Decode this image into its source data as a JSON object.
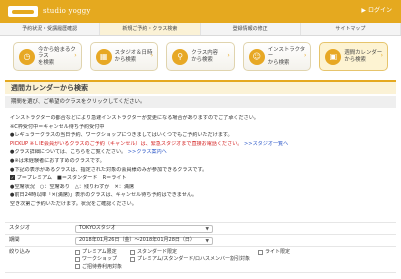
{
  "brand": {
    "name": "studio yoggy",
    "login_label": "ログイン",
    "logo_icon": "studio-logo"
  },
  "colors": {
    "accent": "#e5a91f",
    "highlight": "#fbf2d6",
    "warning": "#d31d1d",
    "link": "#2d58c8"
  },
  "global_nav": [
    "予約状況・受講履歴確認",
    "新規ご予約・クラス検索",
    "登録情報の修正",
    "サイトマップ"
  ],
  "tabs": [
    {
      "icon": "clock-icon",
      "line1": "今から始まるクラス",
      "line2": "を検索"
    },
    {
      "icon": "calendar-icon",
      "line1": "スタジオ＆日時",
      "line2": "から検索"
    },
    {
      "icon": "search-icon",
      "line1": "クラス内容",
      "line2": "から検索"
    },
    {
      "icon": "person-icon",
      "line1": "インストラクター",
      "line2": "から検索"
    },
    {
      "icon": "calendar-week-icon",
      "line1": "週間カレンダー",
      "line2": "から検索"
    }
  ],
  "page": {
    "title": "週間カレンダーから検索",
    "intro": "期間を選び、ご希望のクラスをクリックしてください。"
  },
  "notes": {
    "n1": "インストラクターの都合などにより急遽インストラクターが変更になる場合がありますのでご了承ください。",
    "n2": "※C枠受付中＝キャンセル待ち予約受付中",
    "n3": "●レギュラークラスの当日予約、ワークショップにつきましてはいくつでもご予約いただけます。",
    "n4_badge": "PICKUP",
    "n4_red": "※ＬIE会員がいるクラスのご予約（キャンセル）は、緊急スタジオまで直接お電話ください。",
    "n4_link": ">>スタジオ一覧へ",
    "n5": "●クラス詳細については、こちらをご覧ください。",
    "n5_link": ">>クラス案内へ",
    "n6": "●※は未経験者におすすめのクラスです。",
    "n7": "●下記の表示があるクラスは、指定された対象の会員様のみが参加できるクラスです。",
    "n8": "プ＝プレミアム　■＝スタンダード　R＝ライト",
    "n9": "●空席状況　○：空席あり　△：残りわずか　✕：満席",
    "n10": "●前日24時以降「✕(満席)」表示のクラスは、キャンセル待ち予約はできません。",
    "n11": "空き次第ご予約いただけます。状況をご確認ください。"
  },
  "form": {
    "studio_label": "スタジオ",
    "studio_value": "TOKYOスタジオ",
    "period_label": "期間",
    "period_value": "2018年01月26日（金）～2018年01月28日（日）",
    "filter_label": "絞り込み",
    "filters": [
      "プレミアム限定",
      "スタンダード限定",
      "ライト限定",
      "ワークショップ",
      "プレミアム/スタンダード/ロハスメンバー割引対象",
      "",
      "ご招待券利用対象",
      "",
      ""
    ]
  }
}
